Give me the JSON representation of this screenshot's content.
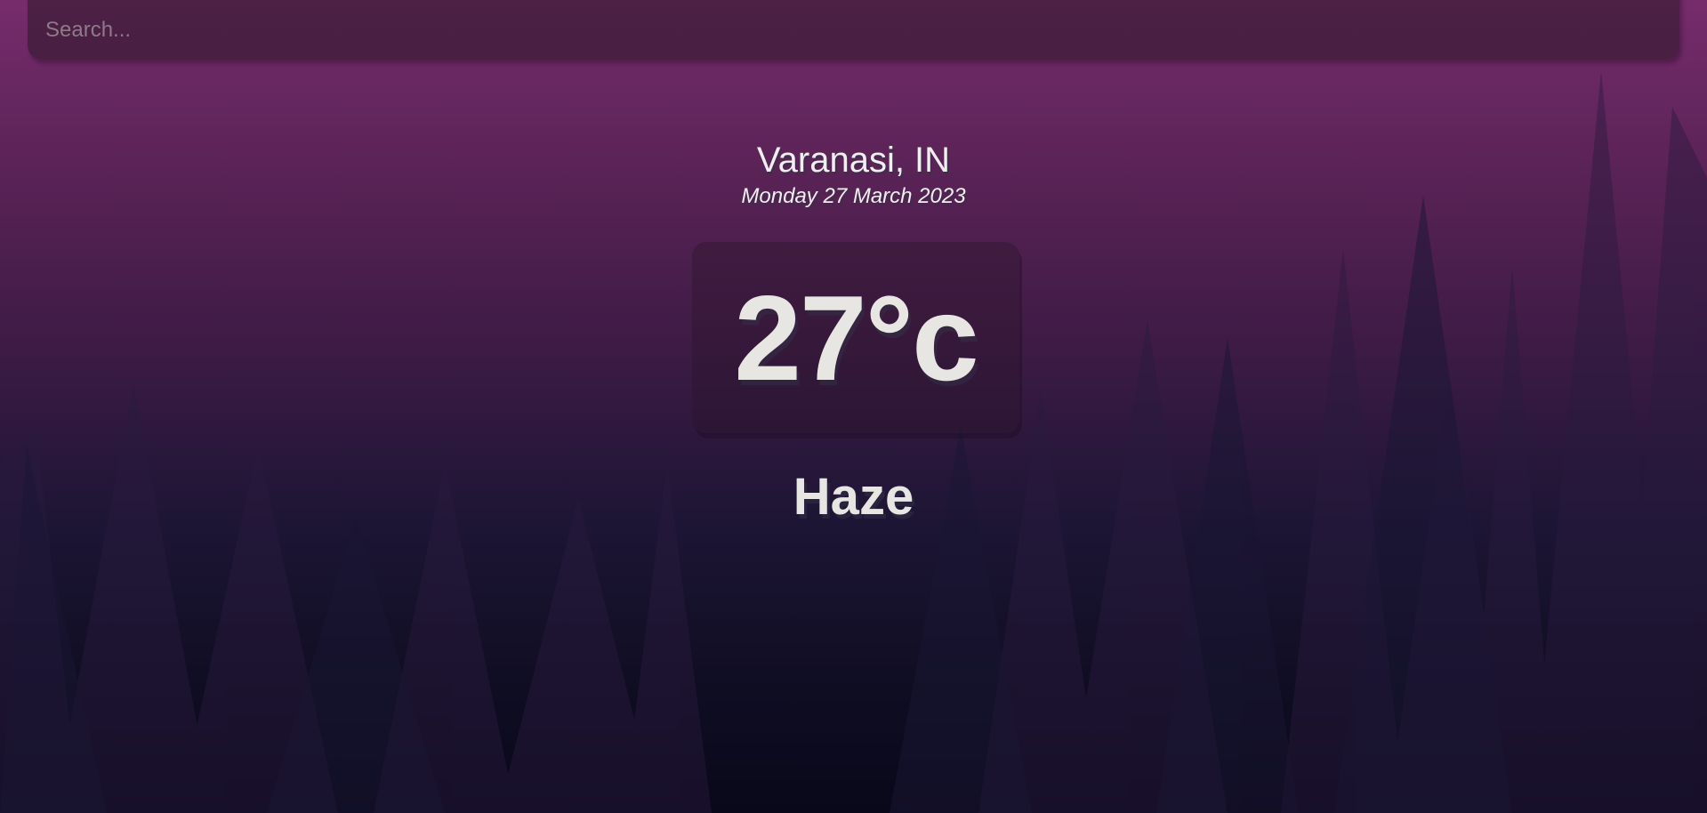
{
  "search": {
    "placeholder": "Search...",
    "value": ""
  },
  "location": {
    "city": "Varanasi, IN",
    "date": "Monday 27 March 2023"
  },
  "weather": {
    "temperature": "27°c",
    "condition": "Haze"
  },
  "colors": {
    "background_top": "#762c6c",
    "background_bottom": "#09081a",
    "text": "#e8e6e3"
  }
}
